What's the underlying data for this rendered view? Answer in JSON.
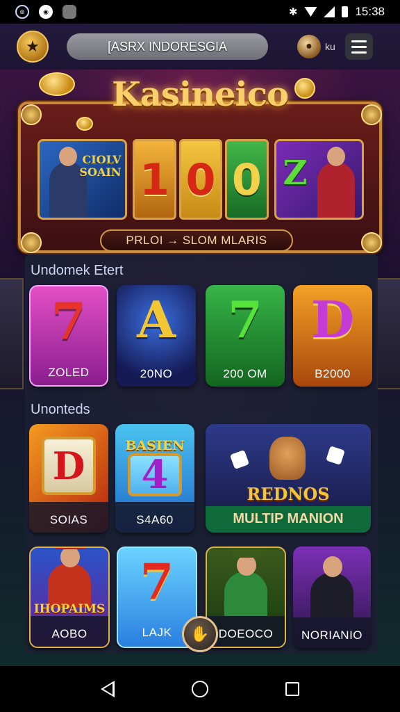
{
  "status_bar": {
    "time": "15:38",
    "icons": [
      "app-icon",
      "messenger-icon",
      "notification-icon",
      "bluetooth-icon",
      "wifi-icon",
      "signal-icon",
      "battery-icon"
    ]
  },
  "app_bar": {
    "title": "[ASRX INDORESGIA",
    "user_label": "ku",
    "icons": [
      "star-icon",
      "coin-avatar-icon",
      "hamburger-menu-icon"
    ]
  },
  "hero": {
    "title": "Kasineico",
    "card1_text": "CIOLV\nSOAIN",
    "reel_digits": [
      "1",
      "0",
      "0"
    ],
    "card2_letter": "Z",
    "pill_label": "PRLOI → SLOM MLARIS"
  },
  "section1": {
    "title": "Undomek Etert",
    "tiles": [
      {
        "symbol": "7",
        "label": "ZOLED"
      },
      {
        "symbol": "A",
        "label": "20NO"
      },
      {
        "symbol": "7",
        "label": "200 OM"
      },
      {
        "symbol": "D",
        "label": "B2000"
      }
    ]
  },
  "section2": {
    "title": "Unonteds",
    "tiles": [
      {
        "symbol": "D",
        "label": "SOIAS"
      },
      {
        "top": "BASIEN",
        "symbol": "4",
        "label": "S4A60"
      },
      {
        "name": "REDNOS",
        "label": "MULTIP MANION"
      }
    ]
  },
  "section3": {
    "tiles": [
      {
        "name": "IHOPAIMS",
        "label": "AOBO"
      },
      {
        "symbol": "7",
        "label": "LAJK"
      },
      {
        "label": "DOEOCO"
      },
      {
        "label": "NORIANIO"
      }
    ]
  },
  "colors": {
    "accent_gold": "#d8a24a",
    "background": "#1a0f2e",
    "panel": "#1c2034"
  }
}
